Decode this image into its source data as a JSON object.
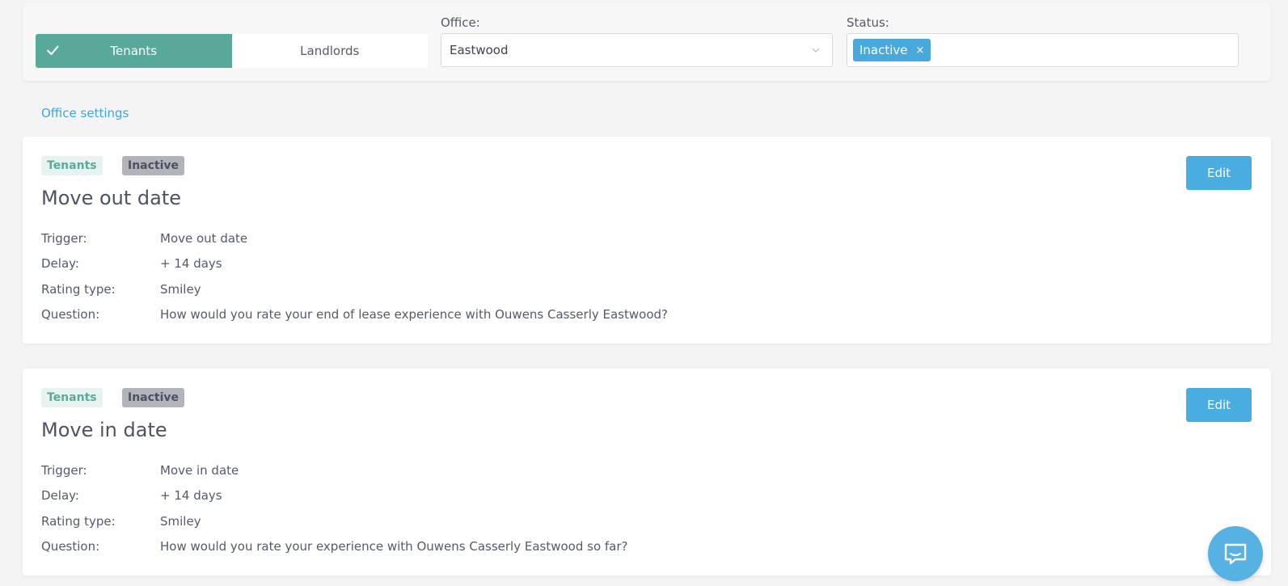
{
  "filters": {
    "segment": [
      {
        "label": "Tenants",
        "active": true,
        "icon": "check-icon"
      },
      {
        "label": "Landlords",
        "active": false
      }
    ],
    "office": {
      "label": "Office:",
      "value": "Eastwood",
      "icon": "chevron-down-icon"
    },
    "status": {
      "label": "Status:",
      "tags": [
        {
          "label": "Inactive",
          "remove": "×"
        }
      ]
    }
  },
  "office_settings_link": "Office settings",
  "cards": [
    {
      "audience_badge": "Tenants",
      "status_badge": "Inactive",
      "title": "Move out date",
      "edit_label": "Edit",
      "details": [
        {
          "key": "Trigger:",
          "value": "Move out date"
        },
        {
          "key": "Delay:",
          "value": "+ 14 days"
        },
        {
          "key": "Rating type:",
          "value": "Smiley"
        },
        {
          "key": "Question:",
          "value": "How would you rate your end of lease experience with Ouwens Casserly Eastwood?"
        }
      ]
    },
    {
      "audience_badge": "Tenants",
      "status_badge": "Inactive",
      "title": "Move in date",
      "edit_label": "Edit",
      "details": [
        {
          "key": "Trigger:",
          "value": "Move in date"
        },
        {
          "key": "Delay:",
          "value": "+ 14 days"
        },
        {
          "key": "Rating type:",
          "value": "Smiley"
        },
        {
          "key": "Question:",
          "value": "How would you rate your experience with Ouwens Casserly Eastwood so far?"
        }
      ]
    }
  ],
  "chat": {
    "icon": "chat-bubble-icon"
  },
  "colors": {
    "primary_teal": "#59a99a",
    "accent_blue": "#4aade0",
    "badge_gray": "#b1b4bb"
  }
}
